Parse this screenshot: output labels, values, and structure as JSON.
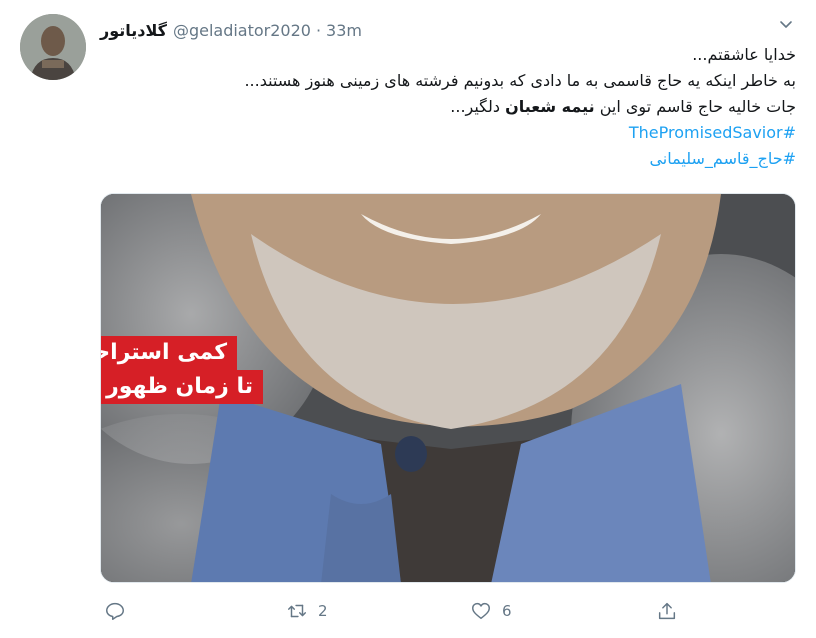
{
  "user": {
    "display_name": "گلادیاتور",
    "handle": "@geladiator2020",
    "separator": "·",
    "time": "33m"
  },
  "tweet": {
    "line1": "خدایا عاشقتم...",
    "line2": "به خاطر اینکه یه حاج قاسمی به ما دادی که بدونیم فرشته های زمینی هنوز هستند...",
    "line3_pre": "جات خالیه حاج قاسم توی این",
    "line3_bold": "نیمه شعبان",
    "line3_post": "دلگیر...",
    "hashtag1": "#ThePromisedSavior",
    "hashtag2": "#حاج_قاسم_سلیمانی"
  },
  "media": {
    "banner_line1": "کمی استراحت کن...",
    "banner_line2": "تا زمان ظهور ان شاالله..."
  },
  "actions": {
    "replies": "",
    "retweets": "2",
    "likes": "6"
  },
  "icons": {
    "caret": "chevron-down-icon",
    "reply": "reply-icon",
    "retweet": "retweet-icon",
    "like": "heart-icon",
    "share": "share-icon"
  },
  "colors": {
    "link": "#1da1f2",
    "secondary_text": "#657786",
    "banner": "#d61f26"
  }
}
